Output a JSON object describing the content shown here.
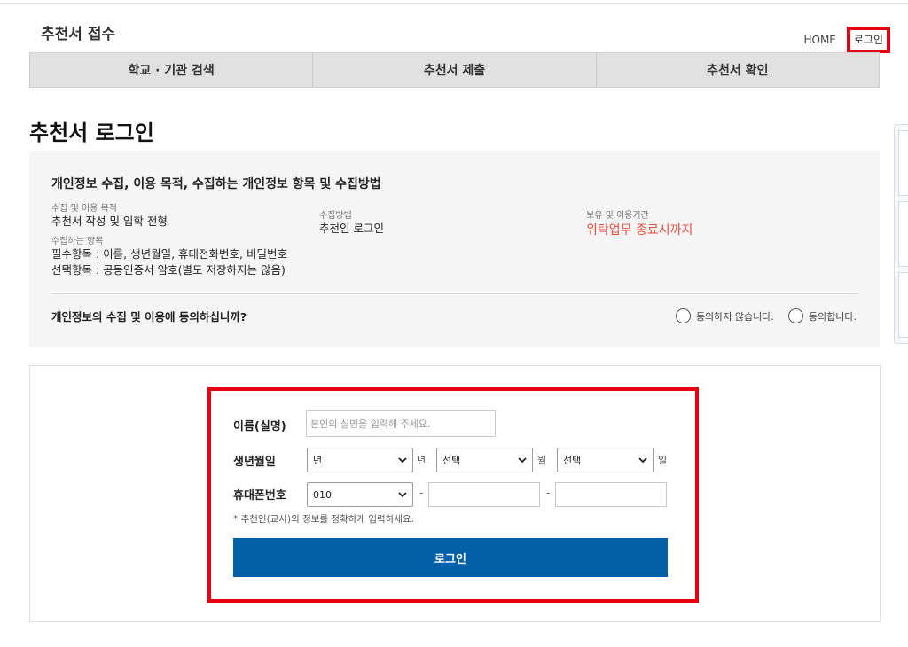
{
  "header": {
    "site_title": "추천서 접수",
    "util": {
      "home": "HOME",
      "login": "로그인"
    }
  },
  "nav": {
    "tabs": [
      {
        "label": "학교 · 기관 검색"
      },
      {
        "label": "추천서 제출"
      },
      {
        "label": "추천서 확인"
      }
    ]
  },
  "page": {
    "title": "추천서 로그인"
  },
  "privacy": {
    "heading": "개인정보 수집, 이용 목적, 수집하는 개인정보 항목 및 수집방법",
    "purpose_label": "수집 및 이용 목적",
    "purpose_value": "추천서 작성 및 입학 전형",
    "items_label": "수집하는 항목",
    "required_items": "필수항목 : 이름, 생년월일, 휴대전화번호, 비밀번호",
    "optional_items": "선택항목 : 공동인증서 암호(별도 저장하지는 않음)",
    "method_label": "수집방법",
    "method_value": "추천인 로그인",
    "period_label": "보유 및 이용기간",
    "period_value": "위탁업무 종료시까지",
    "consent_question": "개인정보의 수집 및 이용에 동의하십니까?",
    "disagree_label": "동의하지 않습니다.",
    "agree_label": "동의합니다."
  },
  "login_form": {
    "name_label": "이름(실명)",
    "name_placeholder": "본인의 실명을 입력해 주세요.",
    "birth_label": "생년월일",
    "year_selected": "년",
    "year_unit": "년",
    "month_selected": "선택",
    "month_unit": "월",
    "day_selected": "선택",
    "day_unit": "일",
    "phone_label": "휴대폰번호",
    "phone_prefix": "010",
    "phone_separator": "-",
    "note": "* 추천인(교사)의 정보를 정확하게 입력하세요.",
    "submit_label": "로그인"
  },
  "colors": {
    "highlight_border": "#e60012",
    "primary_button": "#0360a7",
    "period_text": "#e74c3c",
    "nav_bg": "#e1e1e1",
    "privacy_bg": "#f5f5f5"
  }
}
